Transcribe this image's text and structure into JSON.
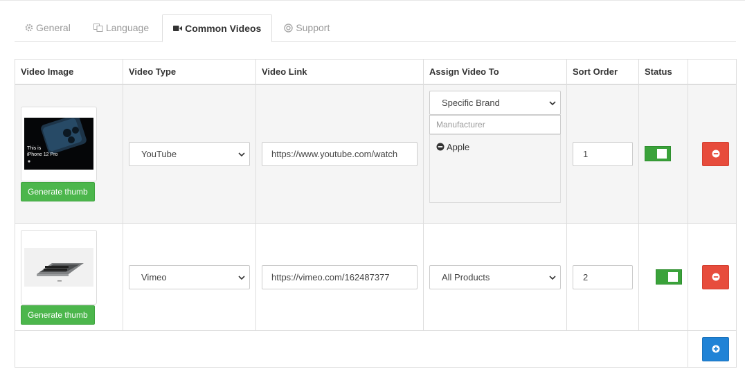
{
  "tabs": [
    {
      "label": "General",
      "icon": "gear-icon",
      "active": false
    },
    {
      "label": "Language",
      "icon": "language-icon",
      "active": false
    },
    {
      "label": "Common Videos",
      "icon": "video-camera-icon",
      "active": true
    },
    {
      "label": "Support",
      "icon": "life-ring-icon",
      "active": false
    }
  ],
  "table": {
    "headers": [
      "Video Image",
      "Video Type",
      "Video Link",
      "Assign Video To",
      "Sort Order",
      "Status",
      ""
    ],
    "rows": [
      {
        "thumb_caption": "This is iPhone 12 Pro",
        "thumb_caption_line1": "This is",
        "thumb_caption_line2": "iPhone 12 Pro",
        "generate_label": "Generate thumb",
        "video_type": "YouTube",
        "video_link": "https://www.youtube.com/watch",
        "assign_to": "Specific Brand",
        "manufacturer_placeholder": "Manufacturer",
        "manufacturers": [
          "Apple"
        ],
        "sort_order": "1",
        "status": "on"
      },
      {
        "generate_label": "Generate thumb",
        "video_type": "Vimeo",
        "video_link": "https://vimeo.com/162487377",
        "assign_to": "All Products",
        "sort_order": "2",
        "status": "on"
      }
    ]
  },
  "colors": {
    "accent_green": "#4cb64c",
    "danger": "#e74c3c",
    "primary": "#2083d6"
  }
}
